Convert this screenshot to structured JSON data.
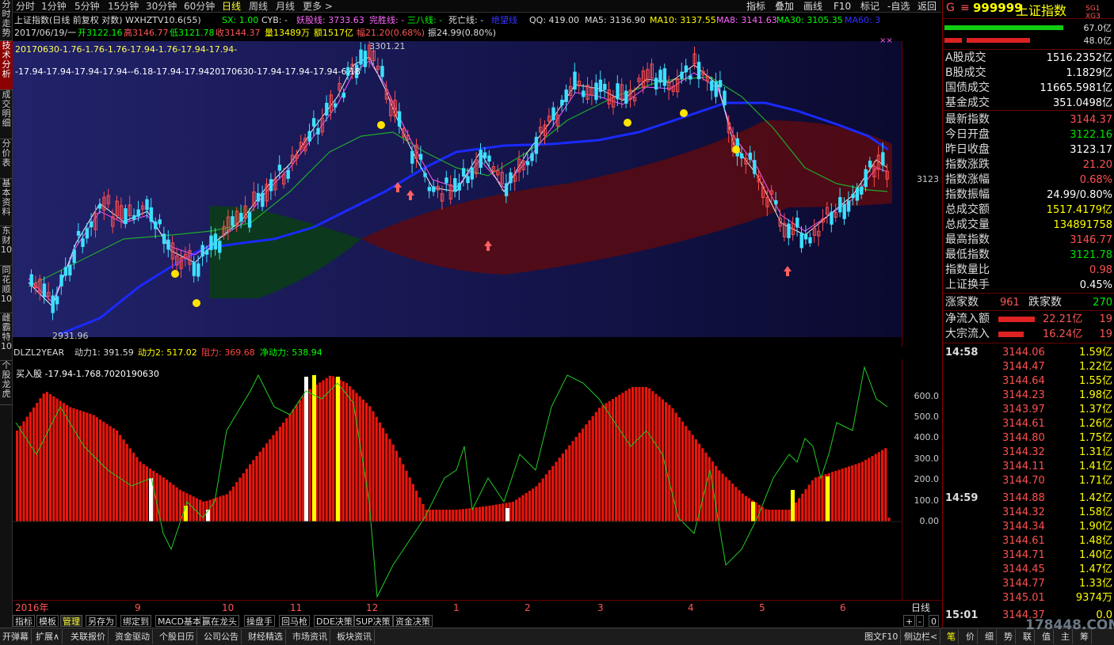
{
  "left_tabs": [
    "分时走势",
    "技术分析",
    "成交明细",
    "分价表",
    "基本资料",
    "东财10",
    "同花顺10",
    "雌霸特10",
    "个股龙虎"
  ],
  "period_bar": {
    "items": [
      "分时",
      "1分钟",
      "5分钟",
      "15分钟",
      "30分钟",
      "60分钟",
      "日线",
      "周线",
      "月线",
      "更多 >"
    ],
    "active": "日线",
    "right_items": [
      "指标",
      "叠加",
      "画线",
      "F10",
      "标记",
      "-自选",
      "返回"
    ]
  },
  "info_row1": {
    "title": "上证指数(日线 前复权 对数) WXHZTV10.6(55)",
    "sx": "SX: 1.00",
    "cyb": "CYB: -",
    "yaogu": "妖股线: 3733.63",
    "wansheng": "完胜线: -",
    "sanba": "三八线: -",
    "sixian": "死亡线: -",
    "juewang": "绝望线",
    "qq": "QQ: 419.00",
    "ma5": "MA5: 3136.90",
    "ma10": "MA10: 3137.55",
    "ma8": "MA8: 3141.63",
    "ma30": "MA30: 3105.35",
    "ma60": "MA60: 3"
  },
  "info_row2": {
    "date": "2017/06/19/一",
    "open": "开3122.16",
    "high": "高3146.77",
    "low": "低3121.78",
    "close": "收3144.37",
    "volume": "量13489万",
    "amount": "额1517亿",
    "change": "幅21.20(0.68%)",
    "amplitude": "振24.99(0.80%)"
  },
  "chart_overlay": {
    "line1": "20170630-1.76-1.76-1.76-17.94-1.76-17.94-17.94-",
    "line2": "-17.94-17.94-17.94-17.94--6.18-17.94-17.9420170630-17.94-17.94-17.94-6.18",
    "high_label": "3301.21",
    "low_label": "2931.96",
    "price_label": "3123",
    "xx": "××"
  },
  "sub_header": {
    "name": "DLZL2YEAR",
    "d1": "动力1: 391.59",
    "d2": "动力2: 517.02",
    "zl": "阻力: 369.68",
    "jd": "净动力: 538.94",
    "line": "买入股 -17.94-1.768.7020190630"
  },
  "sub_axis": [
    "600.0",
    "500.0",
    "400.0",
    "300.0",
    "200.0",
    "100.0",
    "0.00"
  ],
  "date_axis": {
    "labels": [
      "2016年",
      "9",
      "10",
      "11",
      "12",
      "1",
      "2",
      "3",
      "4",
      "5",
      "6"
    ],
    "period": "日线"
  },
  "tool_tabs": [
    "指标",
    "模板",
    "管理",
    "另存为",
    "绑定到",
    "MACD基本",
    "赢在龙头",
    "操盘手",
    "回马枪",
    "DDE决策",
    "SUP决策",
    "资金决策"
  ],
  "tool_tabs_active": "管理",
  "nav_buttons": [
    "+",
    "-",
    "0"
  ],
  "bottom_tabs": [
    "开弹幕",
    "扩展∧",
    "关联报价",
    "资金驱动",
    "个股日历",
    "公司公告",
    "财经精选",
    "市场资讯",
    "板块资讯"
  ],
  "bottom_right": [
    "图文F10",
    "侧边栏<",
    "笔",
    "价",
    "细",
    "势",
    "联",
    "值",
    "主",
    "筹"
  ],
  "right_panel": {
    "code": "999999",
    "name": "上证指数",
    "tag": "SG1 XG3",
    "bar1_value": "67.0亿",
    "bar2_value": "48.0亿",
    "stats_a": [
      {
        "label": "A股成交",
        "value": "1516.2352亿",
        "color": "#ffffff"
      },
      {
        "label": "B股成交",
        "value": "1.1829亿",
        "color": "#ffffff"
      },
      {
        "label": "国债成交",
        "value": "11665.5981亿",
        "color": "#ffffff"
      },
      {
        "label": "基金成交",
        "value": "351.0498亿",
        "color": "#ffffff"
      }
    ],
    "stats_b": [
      {
        "label": "最新指数",
        "value": "3144.37",
        "color": "#ff5050"
      },
      {
        "label": "今日开盘",
        "value": "3122.16",
        "color": "#00e000"
      },
      {
        "label": "昨日收盘",
        "value": "3123.17",
        "color": "#ffffff"
      },
      {
        "label": "指数涨跌",
        "value": "21.20",
        "color": "#ff5050"
      },
      {
        "label": "指数涨幅",
        "value": "0.68%",
        "color": "#ff5050"
      },
      {
        "label": "指数振幅",
        "value": "24.99/0.80%",
        "color": "#ffffff"
      },
      {
        "label": "总成交额",
        "value": "1517.4179亿",
        "color": "#ffff00"
      },
      {
        "label": "总成交量",
        "value": "134891758",
        "color": "#ffff00"
      },
      {
        "label": "最高指数",
        "value": "3146.77",
        "color": "#ff5050"
      },
      {
        "label": "最低指数",
        "value": "3121.78",
        "color": "#00e000"
      },
      {
        "label": "指数量比",
        "value": "0.98",
        "color": "#ff5050"
      },
      {
        "label": "上证换手",
        "value": "0.45%",
        "color": "#ffffff"
      }
    ],
    "up_label": "涨家数",
    "up_value": "961",
    "down_label": "跌家数",
    "down_value": "270",
    "net_in_label": "净流入额",
    "net_in_value": "22.21亿",
    "net_in_rank": "19",
    "big_in_label": "大宗流入",
    "big_in_value": "16.24亿",
    "big_in_rank": "19",
    "ticks": [
      {
        "time": "14:58",
        "price": "3144.06",
        "vol": "1.59亿"
      },
      {
        "time": "",
        "price": "3144.47",
        "vol": "1.22亿"
      },
      {
        "time": "",
        "price": "3144.64",
        "vol": "1.55亿"
      },
      {
        "time": "",
        "price": "3144.23",
        "vol": "1.98亿"
      },
      {
        "time": "",
        "price": "3143.97",
        "vol": "1.37亿"
      },
      {
        "time": "",
        "price": "3144.61",
        "vol": "1.26亿"
      },
      {
        "time": "",
        "price": "3144.80",
        "vol": "1.75亿"
      },
      {
        "time": "",
        "price": "3144.32",
        "vol": "1.31亿"
      },
      {
        "time": "",
        "price": "3144.11",
        "vol": "1.41亿"
      },
      {
        "time": "",
        "price": "3144.70",
        "vol": "1.71亿"
      },
      {
        "time": "14:59",
        "price": "3144.88",
        "vol": "1.42亿"
      },
      {
        "time": "",
        "price": "3144.32",
        "vol": "1.58亿"
      },
      {
        "time": "",
        "price": "3144.34",
        "vol": "1.90亿"
      },
      {
        "time": "",
        "price": "3144.61",
        "vol": "1.48亿"
      },
      {
        "time": "",
        "price": "3144.71",
        "vol": "1.40亿"
      },
      {
        "time": "",
        "price": "3144.45",
        "vol": "1.47亿"
      },
      {
        "time": "",
        "price": "3144.77",
        "vol": "1.33亿"
      },
      {
        "time": "",
        "price": "3145.01",
        "vol": "9374万"
      },
      {
        "time": "15:01",
        "price": "3144.37",
        "vol": "0.0"
      }
    ]
  },
  "watermark": "178448.COM"
}
